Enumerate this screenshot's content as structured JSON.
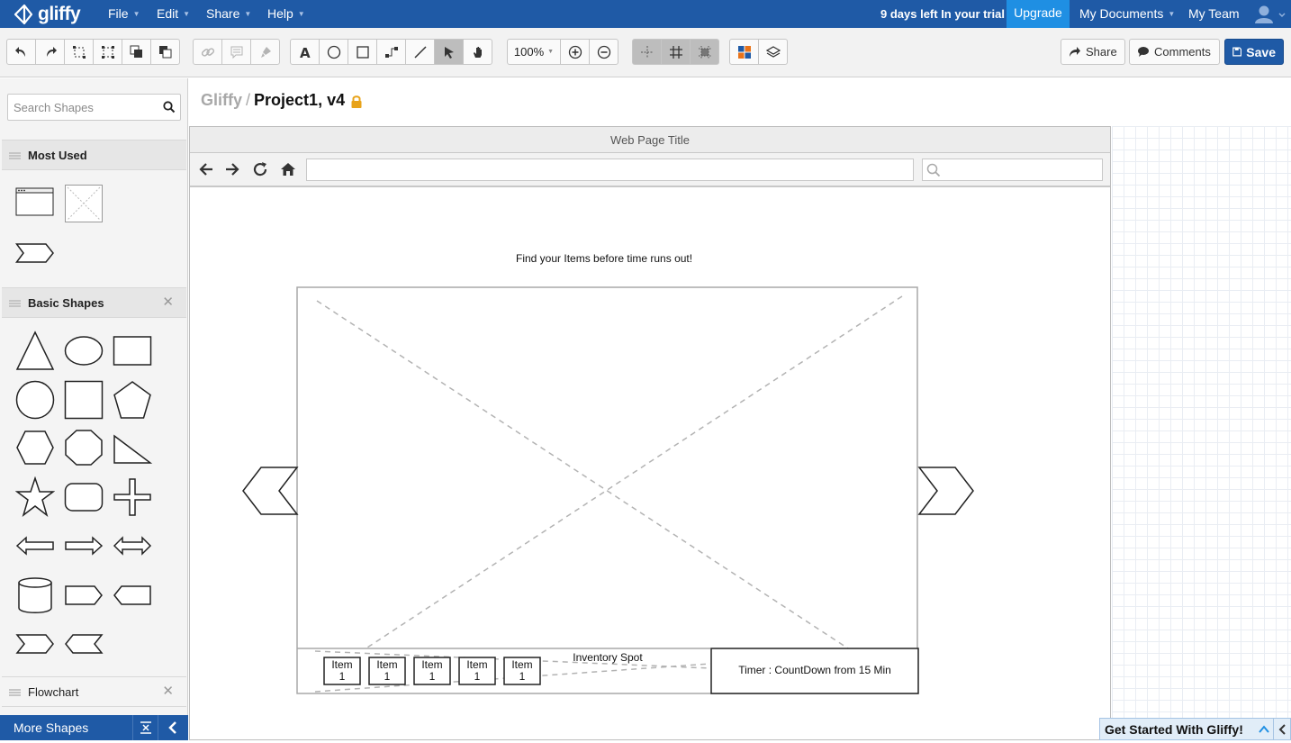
{
  "app": {
    "name": "gliffy",
    "menus": [
      "File",
      "Edit",
      "Share",
      "Help"
    ],
    "trial_text": "9 days left In your trial",
    "upgrade_label": "Upgrade",
    "my_documents": "My Documents",
    "my_team": "My Team"
  },
  "toolbar": {
    "zoom": "100%",
    "share_label": "Share",
    "comments_label": "Comments",
    "save_label": "Save",
    "accent": "#1f5aa6"
  },
  "sidebar": {
    "search_placeholder": "Search Shapes",
    "sections": {
      "most_used": "Most Used",
      "basic_shapes": "Basic Shapes",
      "flowchart": "Flowchart"
    },
    "more_shapes": "More Shapes"
  },
  "document": {
    "root": "Gliffy",
    "separator": "/",
    "name": "Project1, v4"
  },
  "mockup": {
    "page_title": "Web Page Title",
    "headline": "Find your Items before time runs out!",
    "inventory_label": "Inventory Spot",
    "items": [
      "Item\n1",
      "Item\n1",
      "Item\n1",
      "Item\n1",
      "Item\n1"
    ],
    "timer": "Timer : CountDown from 15 Min"
  },
  "footer": {
    "get_started": "Get Started With Gliffy!"
  }
}
